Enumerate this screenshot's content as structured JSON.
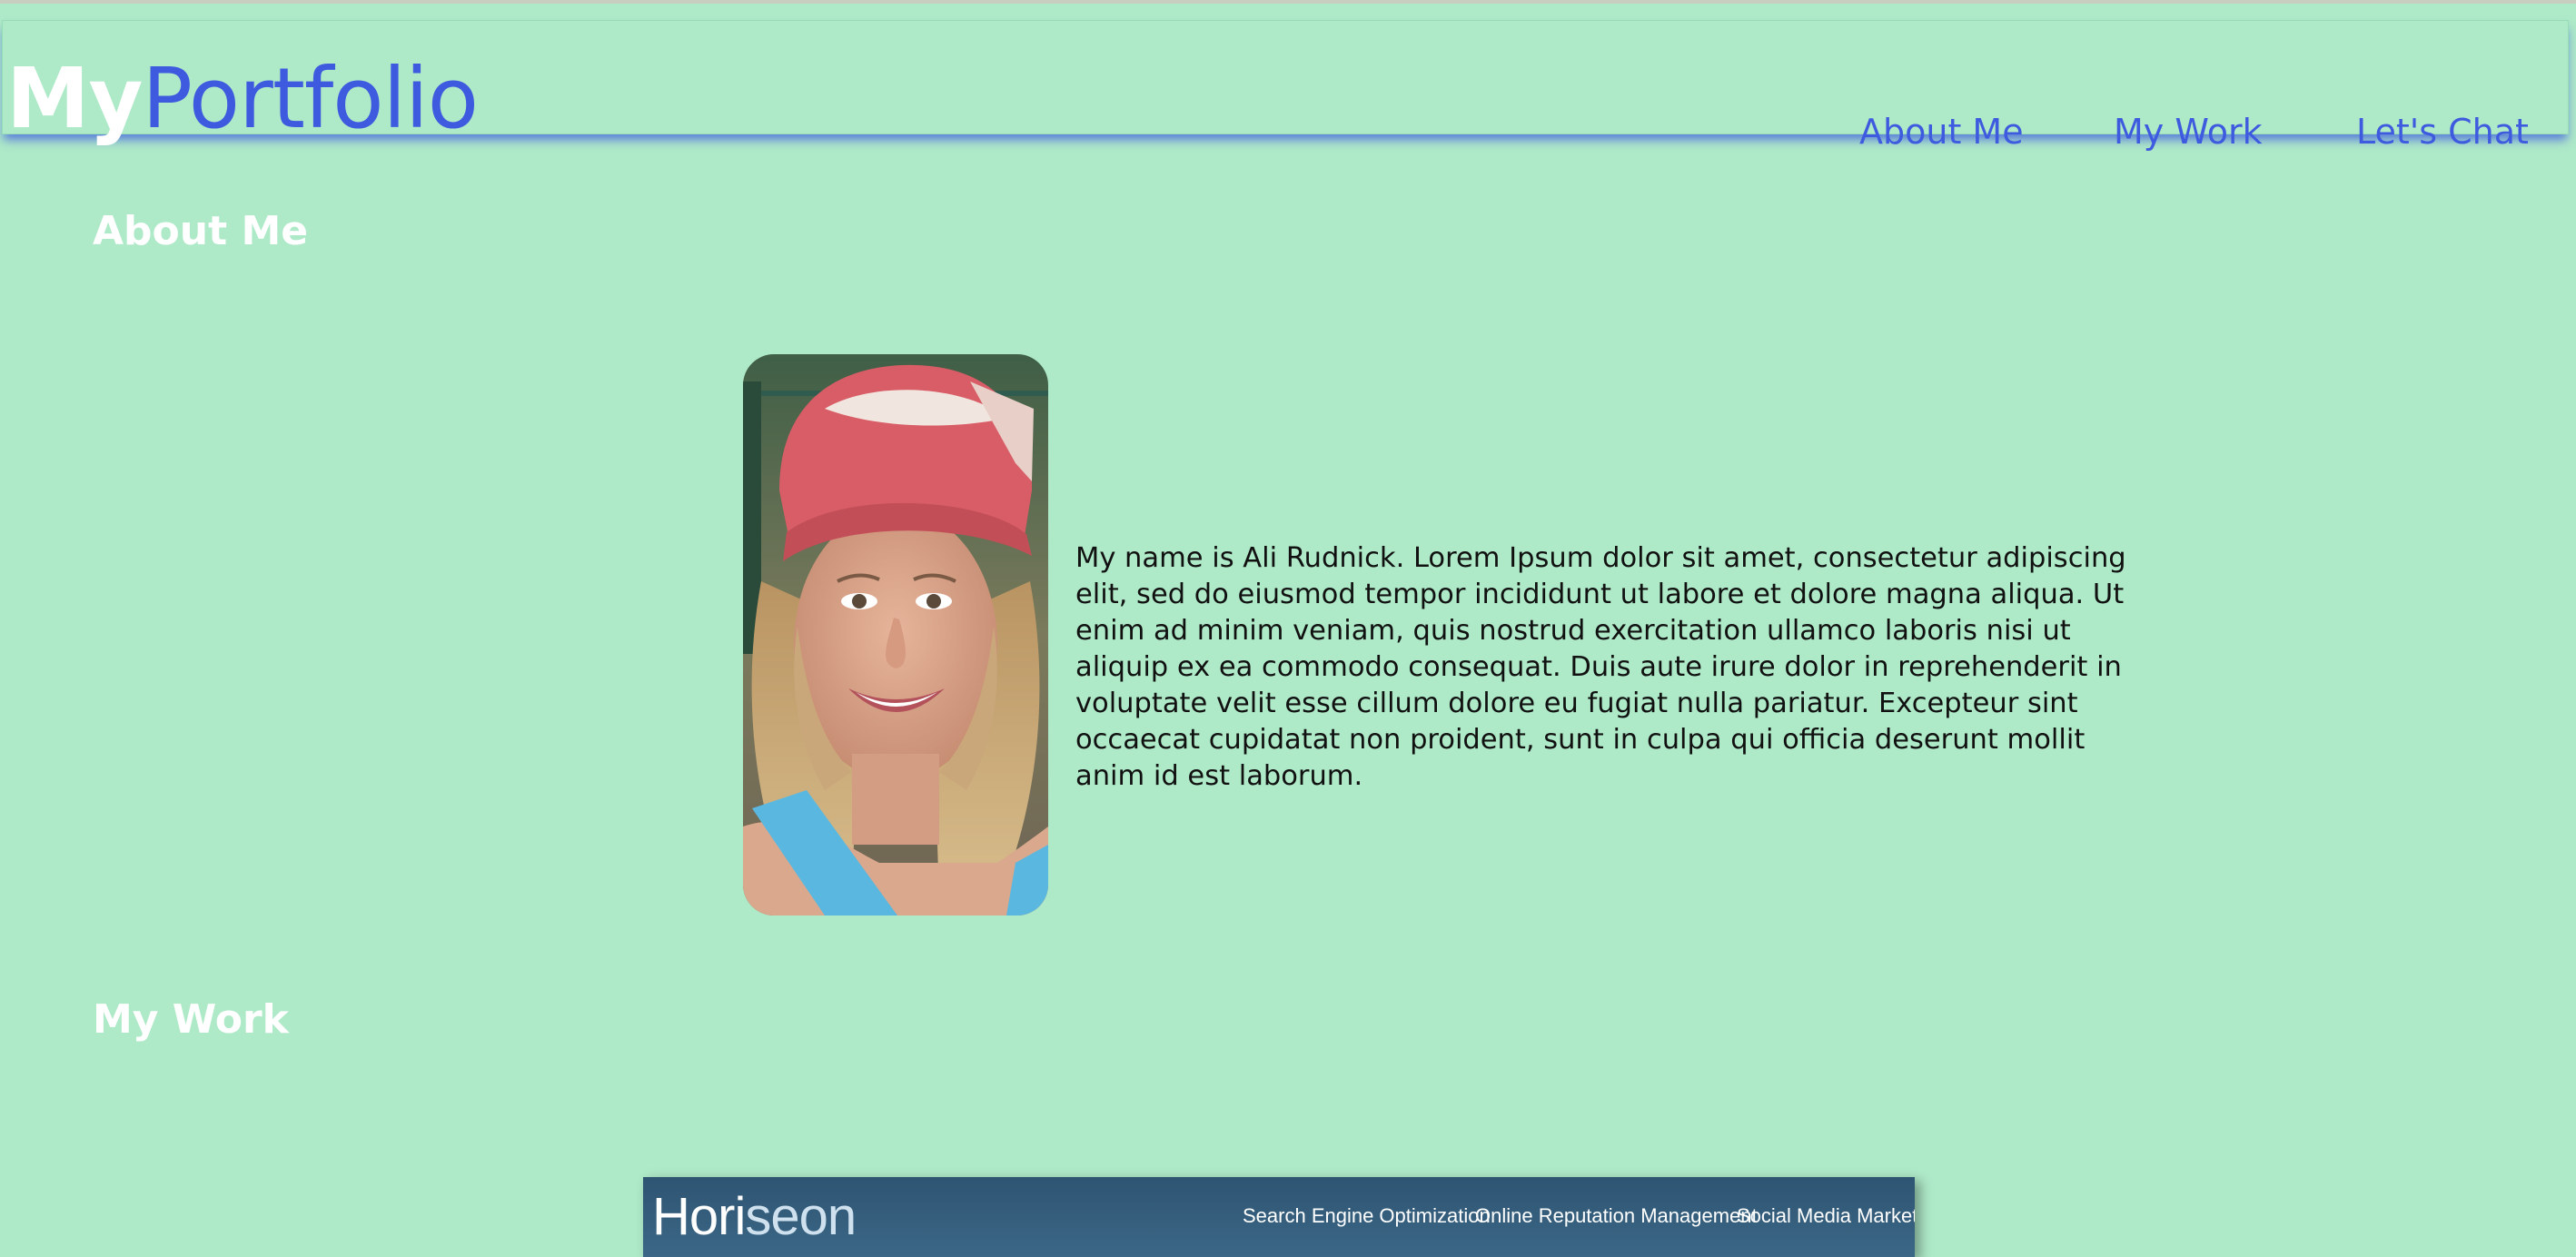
{
  "header": {
    "logo_part1": "My",
    "logo_part2": "Portfolio",
    "nav": [
      {
        "label": "About Me"
      },
      {
        "label": "My Work"
      },
      {
        "label": "Let's Chat"
      }
    ]
  },
  "about": {
    "title": "About Me",
    "bio": "My name is Ali Rudnick. Lorem Ipsum dolor sit amet, consectetur adipiscing elit, sed do eiusmod tempor incididunt ut labore et dolore magna aliqua. Ut enim ad minim veniam, quis nostrud exercitation ullamco laboris nisi ut aliquip ex ea commodo consequat. Duis aute irure dolor in reprehenderit in voluptate velit esse cillum dolore eu fugiat nulla pariatur. Excepteur sint occaecat cupidatat non proident, sunt in culpa qui officia deserunt mollit anim id est laborum."
  },
  "work": {
    "title": "My Work",
    "project": {
      "logo_part1": "Hori",
      "logo_part2": "seon",
      "nav": [
        {
          "label": "Search Engine Optimization"
        },
        {
          "label": "Online Reputation Management"
        },
        {
          "label": "Social Media Marketing"
        }
      ]
    }
  },
  "colors": {
    "background": "#aee9c8",
    "accent": "#3e5be0",
    "project_header": "#2e5572"
  }
}
